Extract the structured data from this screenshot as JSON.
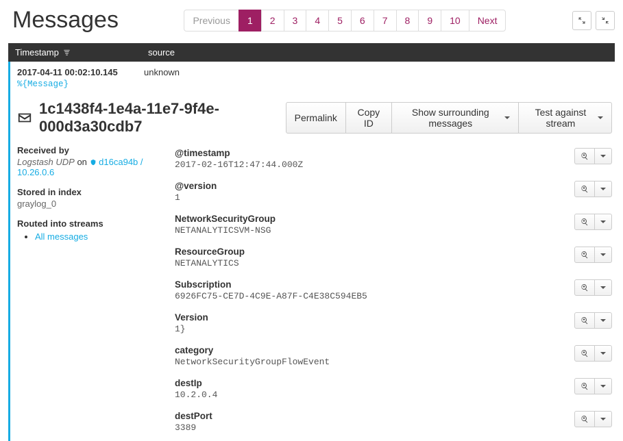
{
  "header": {
    "title": "Messages",
    "pagination": {
      "prev": "Previous",
      "pages": [
        "1",
        "2",
        "3",
        "4",
        "5",
        "6",
        "7",
        "8",
        "9",
        "10"
      ],
      "next": "Next",
      "active_index": 0
    }
  },
  "columns": {
    "timestamp": "Timestamp",
    "source": "source"
  },
  "row": {
    "timestamp": "2017-04-11 00:02:10.145",
    "source": "unknown",
    "raw_line": "%{Message}"
  },
  "detail": {
    "id": "1c1438f4-1e4a-11e7-9f4e-000d3a30cdb7",
    "actions": {
      "permalink": "Permalink",
      "copy_id": "Copy ID",
      "surrounding": "Show surrounding messages",
      "test_stream": "Test against stream"
    },
    "meta": {
      "received_by_label": "Received by",
      "received_input": "Logstash UDP",
      "received_on": "on",
      "received_node": "d16ca94b / 10.26.0.6",
      "stored_label": "Stored in index",
      "stored_value": "graylog_0",
      "routed_label": "Routed into streams",
      "streams": [
        "All messages"
      ]
    },
    "fields": [
      {
        "name": "@timestamp",
        "value": "2017-02-16T12:47:44.000Z"
      },
      {
        "name": "@version",
        "value": "1"
      },
      {
        "name": "NetworkSecurityGroup",
        "value": "NETANALYTICSVM-NSG"
      },
      {
        "name": "ResourceGroup",
        "value": "NETANALYTICS"
      },
      {
        "name": "Subscription",
        "value": "6926FC75-CE7D-4C9E-A87F-C4E38C594EB5"
      },
      {
        "name": "Version",
        "value": "1}"
      },
      {
        "name": "category",
        "value": "NetworkSecurityGroupFlowEvent"
      },
      {
        "name": "destIp",
        "value": "10.2.0.4"
      },
      {
        "name": "destPort",
        "value": "3389"
      }
    ]
  }
}
